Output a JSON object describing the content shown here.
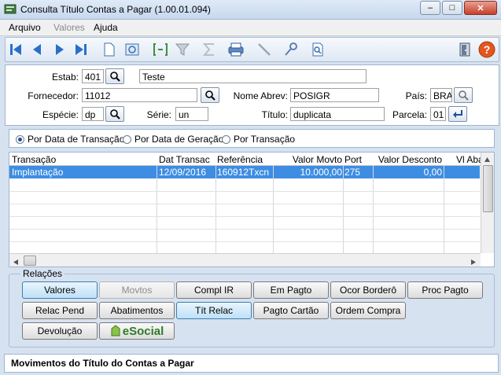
{
  "window": {
    "title": "Consulta Título Contas a Pagar (1.00.01.094)",
    "minimize": "–",
    "maximize": "□",
    "close": "✕"
  },
  "menu": [
    {
      "label": "Arquivo",
      "enabled": true
    },
    {
      "label": "Valores",
      "enabled": false
    },
    {
      "label": "Ajuda",
      "enabled": true
    }
  ],
  "toolbar": {
    "icons": [
      "first-icon",
      "previous-icon",
      "next-icon",
      "last-icon",
      "new-document-icon",
      "preview-icon",
      "range-icon",
      "filter-icon",
      "sum-icon",
      "print-icon",
      "pencil-icon",
      "key-icon",
      "search-document-icon",
      "exit-door-icon",
      "help-icon"
    ]
  },
  "form": {
    "estab_label": "Estab:",
    "estab_value": "401",
    "estab_desc": "Teste",
    "fornecedor_label": "Fornecedor:",
    "fornecedor_value": "11012",
    "nome_abrev_label": "Nome Abrev:",
    "nome_abrev_value": "POSIGR",
    "pais_label": "País:",
    "pais_value": "BRA",
    "especie_label": "Espécie:",
    "especie_value": "dp",
    "serie_label": "Série:",
    "serie_value": "un",
    "titulo_label": "Título:",
    "titulo_value": "duplicata",
    "parcela_label": "Parcela:",
    "parcela_value": "01"
  },
  "sort_options": [
    {
      "label": "Por Data de Transação",
      "selected": true
    },
    {
      "label": "Por Data de Geração",
      "selected": false
    },
    {
      "label": "Por Transação",
      "selected": false
    }
  ],
  "grid": {
    "columns": [
      "Transação",
      "Dat Transac",
      "Referência",
      "Valor Movto",
      "Port",
      "Valor Desconto",
      "Vl Aba"
    ],
    "rows": [
      [
        "Implantação",
        "12/09/2016",
        "160912Txcn",
        "10.000,00",
        "275",
        "0,00",
        ""
      ]
    ]
  },
  "relacoes": {
    "legend": "Relações",
    "buttons": [
      {
        "label": "Valores",
        "state": "active"
      },
      {
        "label": "Movtos",
        "state": "disabled"
      },
      {
        "label": "Compl IR",
        "state": "normal"
      },
      {
        "label": "Em Pagto",
        "state": "normal"
      },
      {
        "label": "Ocor Borderô",
        "state": "normal"
      },
      {
        "label": "Proc Pagto",
        "state": "normal"
      },
      {
        "label": "Relac Pend",
        "state": "normal"
      },
      {
        "label": "Abatimentos",
        "state": "normal"
      },
      {
        "label": "Tít Relac",
        "state": "active"
      },
      {
        "label": "Pagto Cartão",
        "state": "normal"
      },
      {
        "label": "Ordem Compra",
        "state": "normal"
      },
      {
        "label": "Devolução",
        "state": "normal"
      }
    ],
    "esocial_logo": "eSocial"
  },
  "status": "Movimentos do Título do Contas a Pagar",
  "colors": {
    "selection": "#3d8de2",
    "accent": "#1f4f9a"
  }
}
